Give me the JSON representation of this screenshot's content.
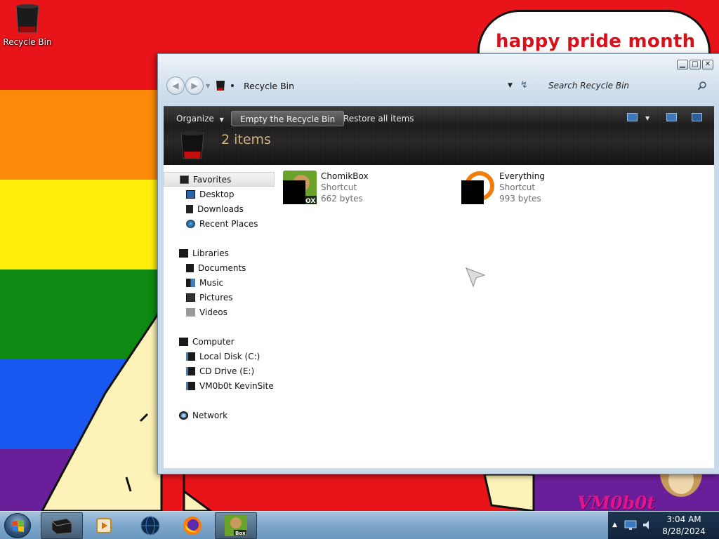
{
  "desktop": {
    "banner_text": "happy pride month",
    "watermark_text": "VM0b0t",
    "icons": [
      {
        "label": "Recycle Bin",
        "icon": "recycle-bin-icon"
      }
    ]
  },
  "window": {
    "address_crumb": "Recycle Bin",
    "search_placeholder": "Search Recycle Bin",
    "controls": [
      "minimize",
      "maximize",
      "close"
    ]
  },
  "command_bar": {
    "organize": "Organize",
    "empty": "Empty the Recycle Bin",
    "restore": "Restore all items",
    "item_count": "2 items"
  },
  "nav": {
    "favorites": {
      "label": "Favorites",
      "items": [
        "Desktop",
        "Downloads",
        "Recent Places"
      ]
    },
    "libraries": {
      "label": "Libraries",
      "items": [
        "Documents",
        "Music",
        "Pictures",
        "Videos"
      ]
    },
    "computer": {
      "label": "Computer",
      "items": [
        "Local Disk (C:)",
        "CD Drive (E:)",
        "VM0b0t KevinSite"
      ]
    },
    "network": {
      "label": "Network"
    }
  },
  "files": [
    {
      "name": "ChomikBox",
      "type": "Shortcut",
      "size": "662 bytes"
    },
    {
      "name": "Everything",
      "type": "Shortcut",
      "size": "993 bytes"
    }
  ],
  "taskbar": {
    "time": "3:04 AM",
    "date": "8/28/2024",
    "pinned": [
      "explorer",
      "media-player",
      "globe-browser",
      "firefox",
      "chomikbox"
    ]
  },
  "colors": {
    "command_bar": "#1b1b1b",
    "item_count_text": "#d8b17a",
    "banner_text": "#d8101c"
  }
}
